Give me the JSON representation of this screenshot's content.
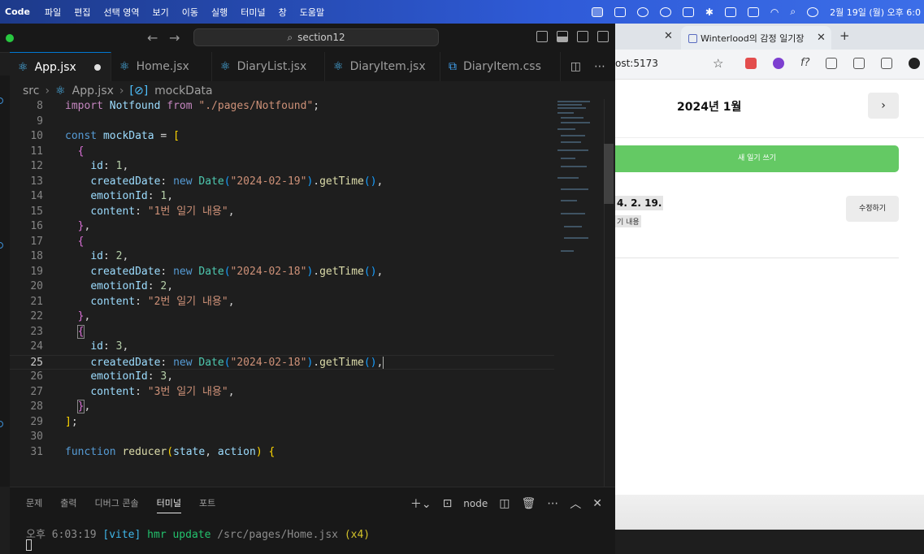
{
  "menubar": {
    "app": "Code",
    "items": [
      "파일",
      "편집",
      "선택 영역",
      "보기",
      "이동",
      "실행",
      "터미널",
      "창",
      "도움말"
    ],
    "clock": "2월 19일 (월) 오후 6:0"
  },
  "vscode": {
    "command_center": "section12",
    "tabs": [
      {
        "label": "App.jsx",
        "icon": "react-icon"
      },
      {
        "label": "Home.jsx",
        "icon": "react-icon"
      },
      {
        "label": "DiaryList.jsx",
        "icon": "react-icon"
      },
      {
        "label": "DiaryItem.jsx",
        "icon": "react-icon"
      },
      {
        "label": "DiaryItem.css",
        "icon": "css-icon"
      }
    ],
    "breadcrumb": {
      "folder": "src",
      "file": "App.jsx",
      "symbol": "mockData"
    },
    "code": {
      "import_line": {
        "kw": "import",
        "name": "Notfound",
        "from": "from",
        "path": "\"./pages/Notfound\""
      },
      "const_kw": "const",
      "var_name": "mockData",
      "items": [
        {
          "id": "1",
          "date": "\"2024-02-19\"",
          "emotion": "1",
          "content": "\"1번 일기 내용\""
        },
        {
          "id": "2",
          "date": "\"2024-02-18\"",
          "emotion": "2",
          "content": "\"2번 일기 내용\""
        },
        {
          "id": "3",
          "date": "\"2024-02-18\"",
          "emotion": "3",
          "content": "\"3번 일기 내용\""
        }
      ],
      "keys": {
        "id": "id",
        "created": "createdDate",
        "emotion": "emotionId",
        "content": "content"
      },
      "new_kw": "new",
      "date_cls": "Date",
      "get_time": "getTime",
      "fn_kw": "function",
      "fn_name": "reducer",
      "fn_params": [
        "state",
        "action"
      ],
      "line_numbers": [
        "8",
        "9",
        "10",
        "11",
        "12",
        "13",
        "14",
        "15",
        "16",
        "17",
        "18",
        "19",
        "20",
        "21",
        "22",
        "23",
        "24",
        "25",
        "26",
        "27",
        "28",
        "29",
        "30",
        "31"
      ]
    },
    "panel": {
      "tabs": [
        "문제",
        "출력",
        "디버그 콘솔",
        "터미널",
        "포트"
      ],
      "active_tab": "터미널",
      "shell": "node",
      "log": {
        "time_prefix": "오후",
        "time": "6:03:19",
        "tag": "[vite]",
        "msg": "hmr update",
        "path": "/src/pages/Home.jsx",
        "count": "(x4)"
      }
    }
  },
  "browser": {
    "tab_title": "Winterlood의 감정 일기장",
    "url": "ost:5173",
    "header_title": "2024년 1월",
    "next_label": "›",
    "new_button": "새 일기 쓰기",
    "item": {
      "date": "4. 2. 19.",
      "content": "기 내용",
      "edit_label": "수정하기"
    }
  }
}
